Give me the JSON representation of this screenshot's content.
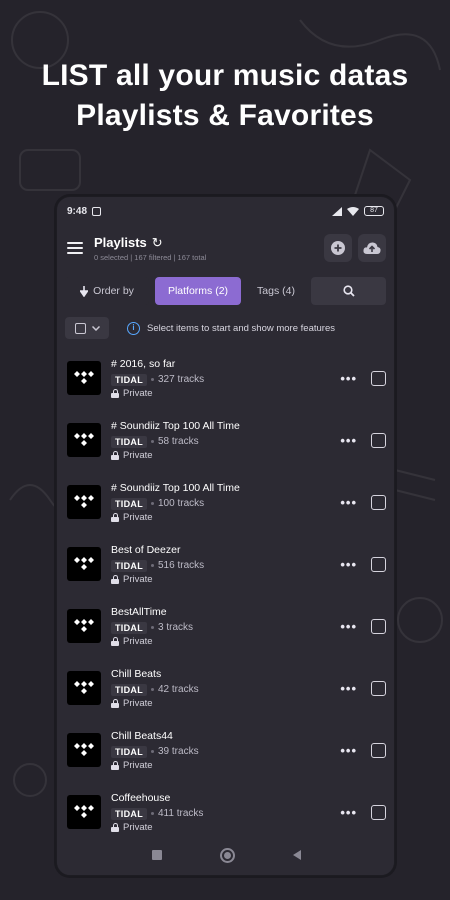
{
  "headline": {
    "line1": "LIST all your music datas",
    "line2": "Playlists & Favorites"
  },
  "statusbar": {
    "time": "9:48",
    "battery": "87",
    "icons": [
      "notification-icon",
      "wifi-icon",
      "signal-icon",
      "battery-icon"
    ]
  },
  "appbar": {
    "title": "Playlists",
    "subtitle": "0 selected | 167 filtered | 167 total",
    "icons": [
      "menu-icon",
      "refresh-icon",
      "add-icon",
      "cloud-upload-icon"
    ]
  },
  "toolbar": {
    "order_label": "Order by",
    "platforms_label": "Platforms (2)",
    "tags_label": "Tags (4)",
    "accent": "#8c6bd2"
  },
  "info": {
    "text": "Select items to start and show more features",
    "accent": "#58a8ff"
  },
  "playlists": [
    {
      "title": "# 2016, so far",
      "platform": "TIDAL",
      "tracks": "327 tracks",
      "privacy": "Private"
    },
    {
      "title": "# Soundiiz Top 100 All Time",
      "platform": "TIDAL",
      "tracks": "58 tracks",
      "privacy": "Private"
    },
    {
      "title": "# Soundiiz Top 100 All Time",
      "platform": "TIDAL",
      "tracks": "100 tracks",
      "privacy": "Private"
    },
    {
      "title": "Best of Deezer",
      "platform": "TIDAL",
      "tracks": "516 tracks",
      "privacy": "Private"
    },
    {
      "title": "BestAllTime",
      "platform": "TIDAL",
      "tracks": "3 tracks",
      "privacy": "Private"
    },
    {
      "title": "Chill Beats",
      "platform": "TIDAL",
      "tracks": "42 tracks",
      "privacy": "Private"
    },
    {
      "title": "Chill Beats44",
      "platform": "TIDAL",
      "tracks": "39 tracks",
      "privacy": "Private"
    },
    {
      "title": "Coffeehouse",
      "platform": "TIDAL",
      "tracks": "411 tracks",
      "privacy": "Private"
    }
  ],
  "more_label": "•••"
}
